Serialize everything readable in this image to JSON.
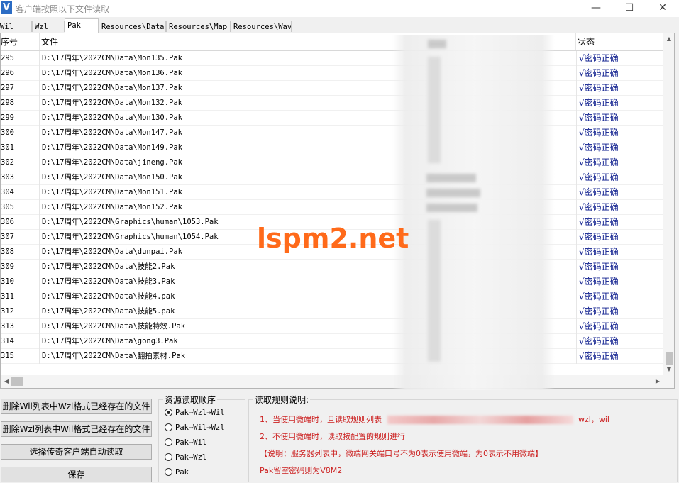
{
  "window": {
    "title": "客户端按照以下文件读取",
    "app_icon_letter": "V",
    "controls": {
      "minimize": "—",
      "maximize": "☐",
      "close": "✕"
    }
  },
  "tabs": [
    {
      "label": "Wil",
      "active": false
    },
    {
      "label": "Wzl",
      "active": false
    },
    {
      "label": "Pak",
      "active": true
    },
    {
      "label": "Resources\\Data",
      "active": false
    },
    {
      "label": "Resources\\Map",
      "active": false
    },
    {
      "label": "Resources\\Wav",
      "active": false
    }
  ],
  "list": {
    "columns": {
      "index": "序号",
      "file": "文件",
      "status": "状态"
    },
    "rows": [
      {
        "index": "295",
        "file": "D:\\17周年\\2022CM\\Data\\Mon135.Pak",
        "status": "√密码正确"
      },
      {
        "index": "296",
        "file": "D:\\17周年\\2022CM\\Data\\Mon136.Pak",
        "status": "√密码正确"
      },
      {
        "index": "297",
        "file": "D:\\17周年\\2022CM\\Data\\Mon137.Pak",
        "status": "√密码正确"
      },
      {
        "index": "298",
        "file": "D:\\17周年\\2022CM\\Data\\Mon132.Pak",
        "status": "√密码正确"
      },
      {
        "index": "299",
        "file": "D:\\17周年\\2022CM\\Data\\Mon130.Pak",
        "status": "√密码正确"
      },
      {
        "index": "300",
        "file": "D:\\17周年\\2022CM\\Data\\Mon147.Pak",
        "status": "√密码正确"
      },
      {
        "index": "301",
        "file": "D:\\17周年\\2022CM\\Data\\Mon149.Pak",
        "status": "√密码正确"
      },
      {
        "index": "302",
        "file": "D:\\17周年\\2022CM\\Data\\jineng.Pak",
        "status": "√密码正确"
      },
      {
        "index": "303",
        "file": "D:\\17周年\\2022CM\\Data\\Mon150.Pak",
        "status": "√密码正确"
      },
      {
        "index": "304",
        "file": "D:\\17周年\\2022CM\\Data\\Mon151.Pak",
        "status": "√密码正确"
      },
      {
        "index": "305",
        "file": "D:\\17周年\\2022CM\\Data\\Mon152.Pak",
        "status": "√密码正确"
      },
      {
        "index": "306",
        "file": "D:\\17周年\\2022CM\\Graphics\\human\\1053.Pak",
        "status": "√密码正确"
      },
      {
        "index": "307",
        "file": "D:\\17周年\\2022CM\\Graphics\\human\\1054.Pak",
        "status": "√密码正确"
      },
      {
        "index": "308",
        "file": "D:\\17周年\\2022CM\\Data\\dunpai.Pak",
        "status": "√密码正确"
      },
      {
        "index": "309",
        "file": "D:\\17周年\\2022CM\\Data\\技能2.Pak",
        "status": "√密码正确"
      },
      {
        "index": "310",
        "file": "D:\\17周年\\2022CM\\Data\\技能3.Pak",
        "status": "√密码正确"
      },
      {
        "index": "311",
        "file": "D:\\17周年\\2022CM\\Data\\技能4.pak",
        "status": "√密码正确"
      },
      {
        "index": "312",
        "file": "D:\\17周年\\2022CM\\Data\\技能5.pak",
        "status": "√密码正确"
      },
      {
        "index": "313",
        "file": "D:\\17周年\\2022CM\\Data\\技能特效.Pak",
        "status": "√密码正确"
      },
      {
        "index": "314",
        "file": "D:\\17周年\\2022CM\\Data\\gong3.Pak",
        "status": "√密码正确"
      },
      {
        "index": "315",
        "file": "D:\\17周年\\2022CM\\Data\\翻拍素材.Pak",
        "status": "√密码正确"
      }
    ]
  },
  "buttons": {
    "delete_wil": "删除Wil列表中Wzl格式已经存在的文件",
    "delete_wzl": "删除Wzl列表中Wil格式已经存在的文件",
    "auto_read": "选择传奇客户端自动读取",
    "save": "保存"
  },
  "resource_order": {
    "title": "资源读取顺序",
    "options": [
      {
        "label": "Pak→Wzl→Wil",
        "selected": true
      },
      {
        "label": "Pak→Wil→Wzl",
        "selected": false
      },
      {
        "label": "Pak→Wil",
        "selected": false
      },
      {
        "label": "Pak→Wzl",
        "selected": false
      },
      {
        "label": "Pak",
        "selected": false
      }
    ]
  },
  "rules": {
    "title": "读取规则说明:",
    "line1_prefix": "1、当使用微端时，且读取规则列表",
    "line1_suffix": "wzl，wil",
    "line2": "2、不使用微端时，读取按配置的规则进行",
    "line3": "【说明：服务器列表中，微端网关端口号不为0表示使用微端，为0表示不用微端】",
    "line4": "Pak留空密码则为V8M2",
    "color": "#cc2222"
  },
  "watermark": "lspm2.net",
  "colors": {
    "status_text": "#0a1a8c",
    "watermark": "#ff6a1a"
  }
}
